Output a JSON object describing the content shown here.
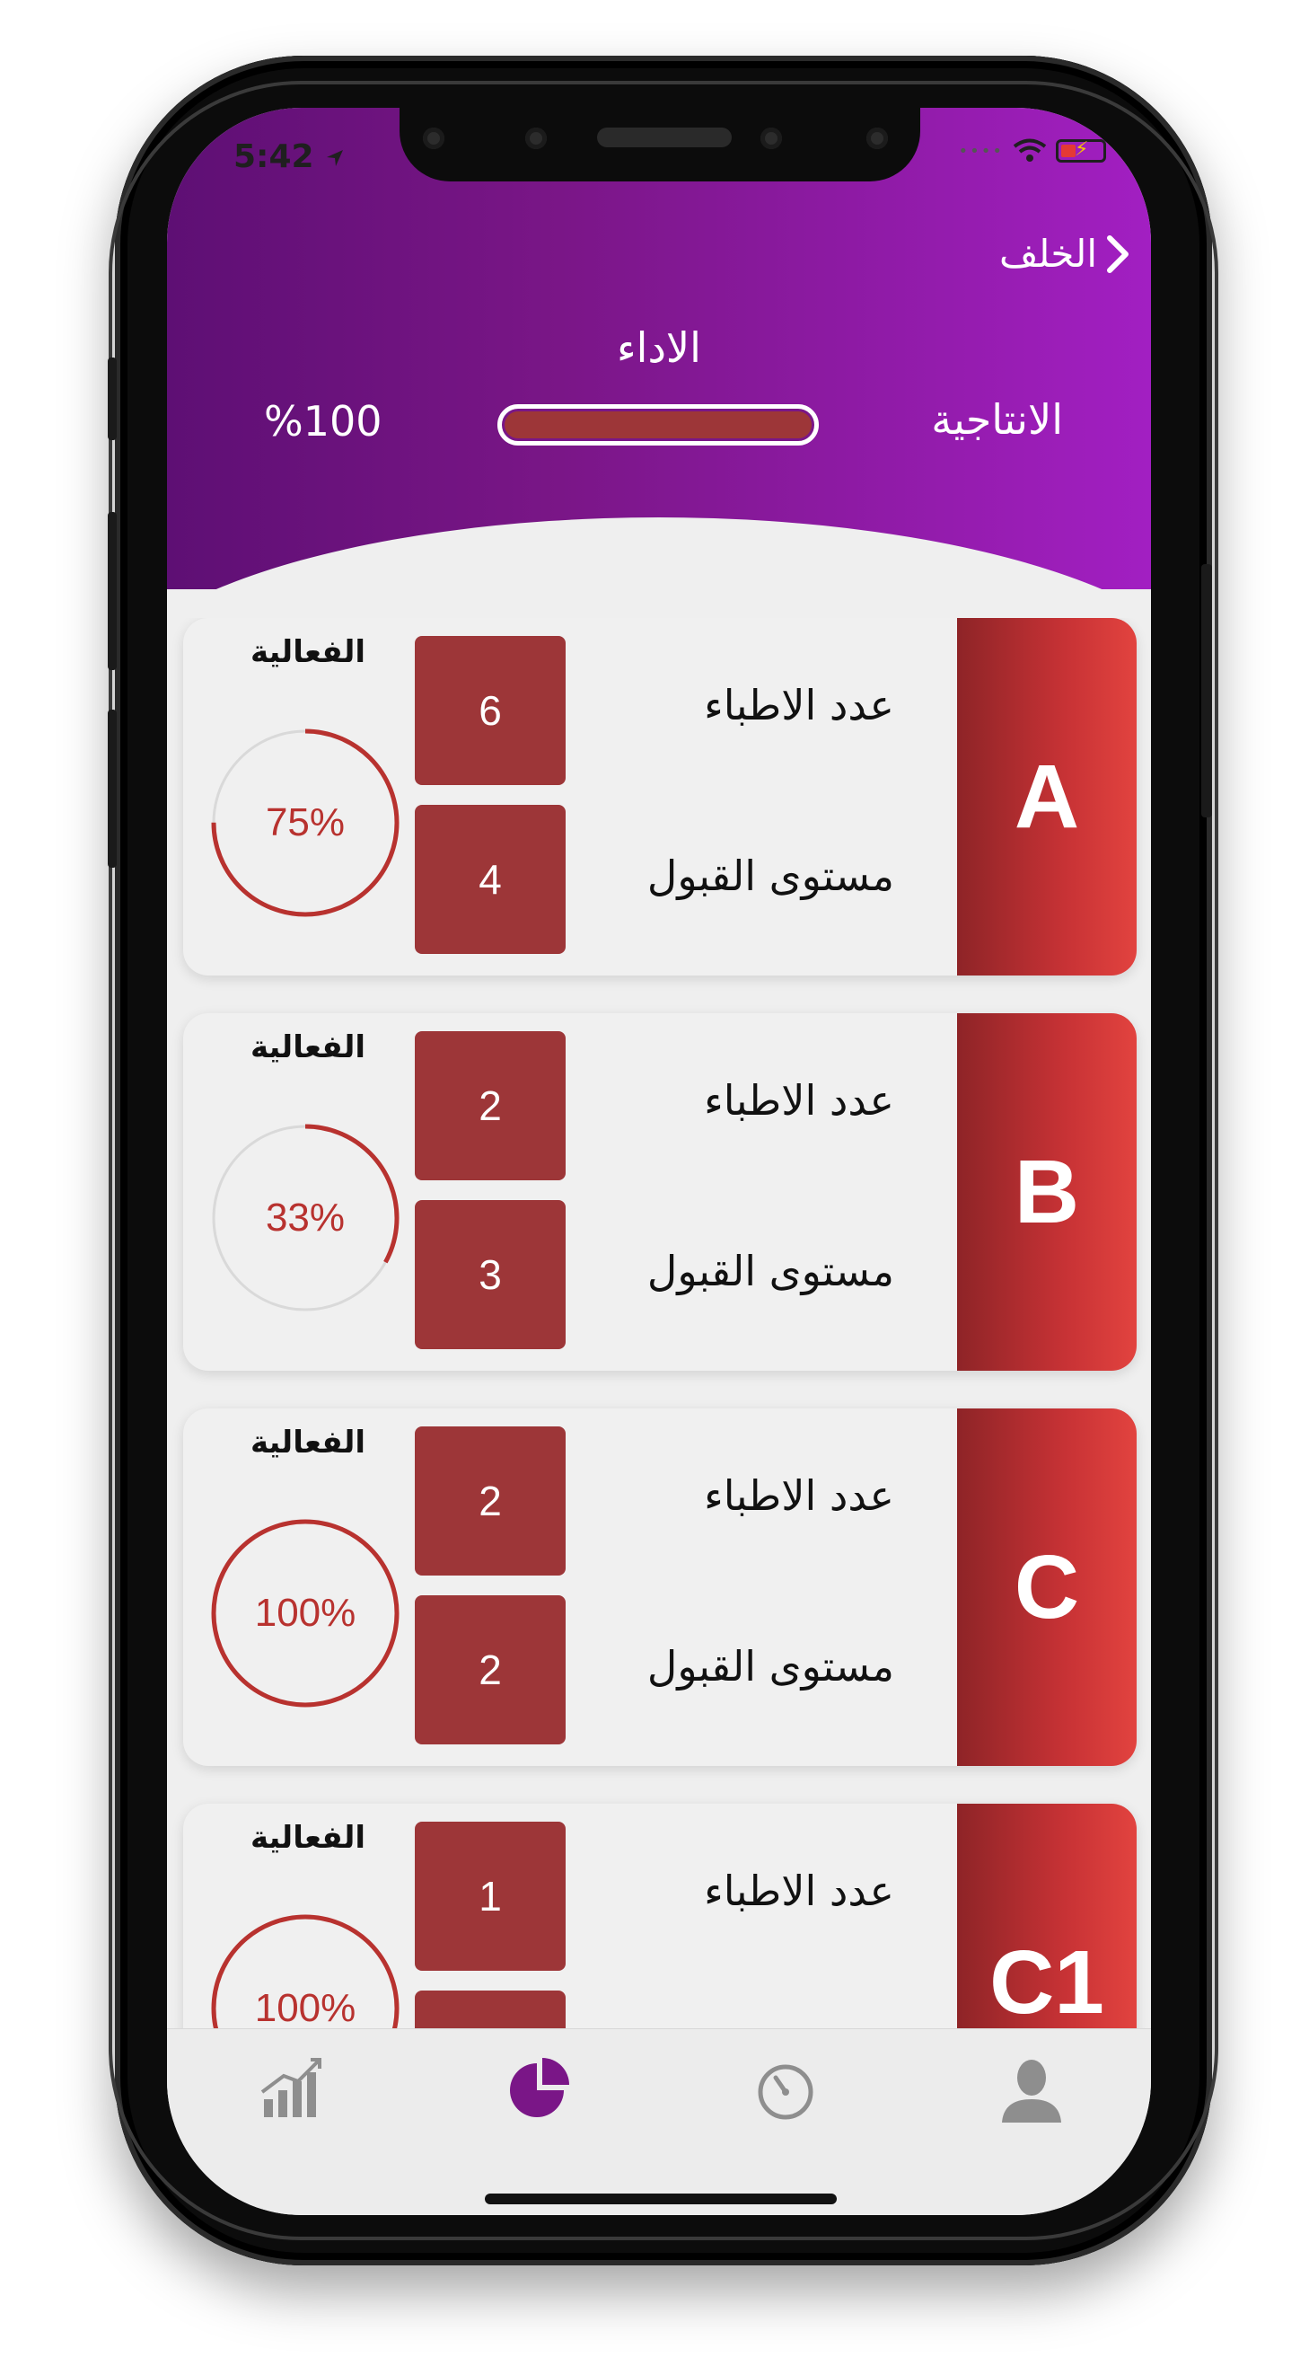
{
  "status_bar": {
    "time": "5:42"
  },
  "header": {
    "back_label": "الخلف",
    "title": "الاداء",
    "productivity_label": "الانتاجية",
    "productivity_value": "%100",
    "productivity_progress": 1.0
  },
  "labels": {
    "doctors_count": "عدد الاطباء",
    "acceptance_level": "مستوى القبول",
    "effectiveness": "الفعالية"
  },
  "cards": [
    {
      "grade": "A",
      "doctors": "6",
      "acceptance": "4",
      "effectiveness": "75%",
      "ratio": 0.75
    },
    {
      "grade": "B",
      "doctors": "2",
      "acceptance": "3",
      "effectiveness": "33%",
      "ratio": 0.33
    },
    {
      "grade": "C",
      "doctors": "2",
      "acceptance": "2",
      "effectiveness": "100%",
      "ratio": 1.0
    },
    {
      "grade": "C1",
      "doctors": "1",
      "acceptance": "",
      "effectiveness": "100%",
      "ratio": 1.0
    }
  ],
  "tabbar": {
    "items": [
      {
        "icon": "stats-chart-icon",
        "active": false
      },
      {
        "icon": "pie-chart-icon",
        "active": true
      },
      {
        "icon": "timer-icon",
        "active": false
      },
      {
        "icon": "user-icon",
        "active": false
      }
    ],
    "active_color": "#7a1687",
    "inactive_color": "#8e8e8e"
  },
  "colors": {
    "accent": "#9d3638",
    "header_start": "#5e0f74",
    "header_end": "#a21fc2"
  }
}
